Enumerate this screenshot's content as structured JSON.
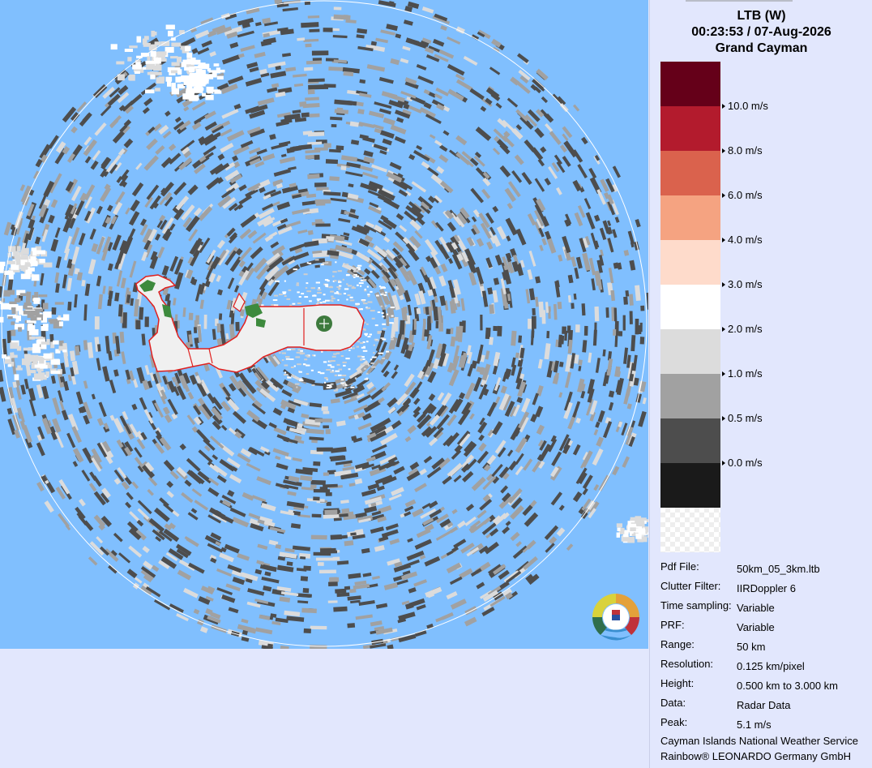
{
  "header": {
    "title": "LTB (W)",
    "datetime": "00:23:53 / 07-Aug-2026",
    "location": "Grand Cayman"
  },
  "legend": {
    "colors": [
      "#650019",
      "#b31b2d",
      "#da624d",
      "#f5a381",
      "#fedbcb",
      "#ffffff",
      "#dcdcdc",
      "#a1a1a1",
      "#4d4d4d",
      "#1a1a1a"
    ],
    "labels": [
      "10.0 m/s",
      "8.0 m/s",
      "6.0 m/s",
      "4.0 m/s",
      "3.0 m/s",
      "2.0 m/s",
      "1.0 m/s",
      "0.5 m/s",
      "0.0 m/s"
    ]
  },
  "info": [
    {
      "label": "Pdf File:",
      "value": "50km_05_3km.ltb"
    },
    {
      "label": "Clutter Filter:",
      "value": "IIRDoppler 6"
    },
    {
      "label": "Time sampling:",
      "value": "Variable"
    },
    {
      "label": "PRF:",
      "value": "Variable"
    },
    {
      "label": "Range:",
      "value": "50 km"
    },
    {
      "label": "Resolution:",
      "value": "0.125 km/pixel"
    },
    {
      "label": "Height:",
      "value": "0.500 km to 3.000 km"
    },
    {
      "label": "Data:",
      "value": "Radar Data"
    },
    {
      "label": "Peak:",
      "value": "5.1 m/s"
    }
  ],
  "credits": {
    "line1": "Cayman Islands National Weather Service",
    "line2": "Rainbow® LEONARDO Germany GmbH"
  },
  "map": {
    "background_color": "#80bffe",
    "range_ring_color": "#ffffff",
    "coastline_color": "#e0201e",
    "land_green": "#3d8a3d",
    "radar_marker_color": "#3d7a3d"
  }
}
